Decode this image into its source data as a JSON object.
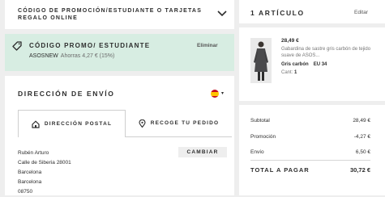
{
  "promo_header": {
    "title": "CÓDIGO DE PROMOCIÓN/ESTUDIANTE O TARJETAS REGALO ONLINE",
    "icon": "chevron-down-icon"
  },
  "promo_applied": {
    "title": "CÓDIGO PROMO/ ESTUDIANTE",
    "remove_label": "Eliminar",
    "code": "ASOSNEW",
    "savings": "Ahorras 4,27 € (15%)",
    "background": "#d7ede2",
    "icon": "tag-icon"
  },
  "shipping": {
    "title": "DIRECCIÓN DE ENVÍO",
    "country_icon": "spain-flag-icon",
    "tabs": [
      {
        "label": "DIRECCIÓN POSTAL",
        "icon": "home-icon"
      },
      {
        "label": "RECOGE TU PEDIDO",
        "icon": "location-pin-icon"
      }
    ],
    "address_lines": [
      "Rubén Arturo",
      "Calle de Siberia 28001",
      "Barcelona",
      "Barcelona",
      "08750"
    ],
    "change_label": "CAMBIAR"
  },
  "summary": {
    "title": "1 ARTÍCULO",
    "edit_label": "Editar",
    "product": {
      "price": "28,49 €",
      "name": "Gabardina de sastre gris carbón de tejido suave de ASOS...",
      "color": "Gris carbón",
      "size": "EU 34",
      "qty_label": "Cant:",
      "qty": "1"
    },
    "rows": [
      {
        "label": "Subtotal",
        "value": "28,49 €"
      },
      {
        "label": "Promoción",
        "value": "-4,27 €"
      },
      {
        "label": "Envío",
        "value": "6,50 €"
      }
    ],
    "total_label": "TOTAL A PAGAR",
    "total_value": "30,72 €"
  }
}
